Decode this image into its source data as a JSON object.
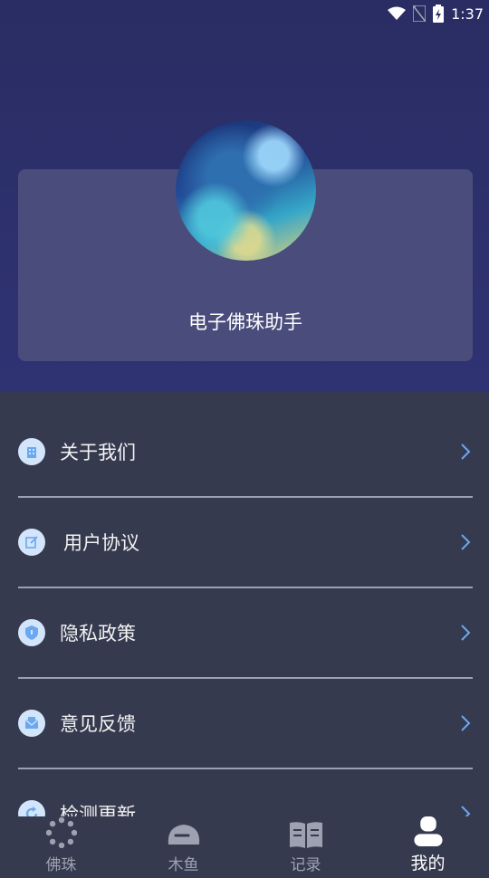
{
  "status_bar": {
    "time": "1:37"
  },
  "profile": {
    "app_name": "电子佛珠助手"
  },
  "menu": [
    {
      "label": "关于我们",
      "icon": "building-icon"
    },
    {
      "label": "用户协议",
      "icon": "edit-icon"
    },
    {
      "label": "隐私政策",
      "icon": "shield-icon"
    },
    {
      "label": "意见反馈",
      "icon": "mail-icon"
    },
    {
      "label": "检测更新",
      "icon": "refresh-icon"
    }
  ],
  "tabs": [
    {
      "label": "佛珠",
      "icon": "beads-icon"
    },
    {
      "label": "木鱼",
      "icon": "wooden-fish-icon"
    },
    {
      "label": "记录",
      "icon": "book-icon"
    },
    {
      "label": "我的",
      "icon": "user-icon",
      "active": true
    }
  ],
  "colors": {
    "header_bg": "#2a2d63",
    "card_bg": "#4a4d7c",
    "body_bg": "#363a4f",
    "menu_icon_bg": "#d3e5fb",
    "accent_icon": "#6aa8f0"
  }
}
